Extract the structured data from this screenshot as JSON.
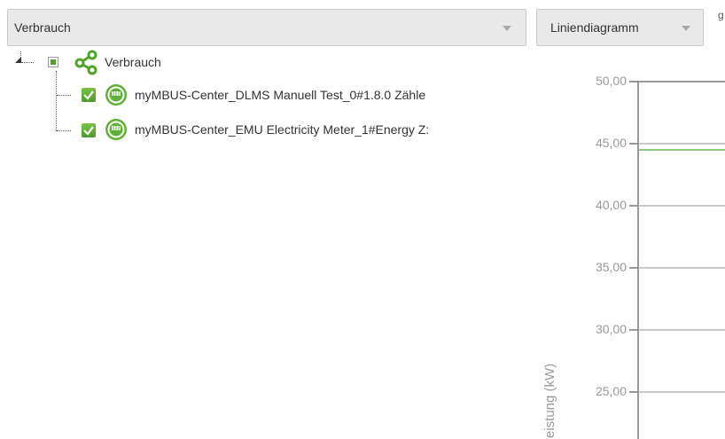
{
  "toolbar": {
    "source_select": {
      "value": "Verbrauch"
    },
    "chart_type_select": {
      "value": "Liniendiagramm"
    },
    "clipped_text": "g"
  },
  "tree": {
    "root": {
      "label": "Verbrauch",
      "icon": "share-icon"
    },
    "children": [
      {
        "label": "myMBUS-Center_DLMS Manuell Test_0#1.8.0 Zähle",
        "icon": "meter-icon",
        "checked": true
      },
      {
        "label": "myMBUS-Center_EMU Electricity Meter_1#Energy Z:",
        "icon": "meter-icon",
        "checked": true
      }
    ]
  },
  "chart_data": {
    "type": "line",
    "ylabel": "eistung (kW)",
    "yticks": [
      "50,00",
      "45,00",
      "40,00",
      "35,00",
      "30,00",
      "25,00"
    ],
    "ylim_visible": [
      22.5,
      50
    ],
    "grid": true,
    "series": [
      {
        "color": "#8cc97a",
        "values": [
          44.5
        ]
      }
    ]
  },
  "colors": {
    "accent_green": "#4fa32b",
    "grid": "#b5b5b5",
    "axis_text": "#999999"
  }
}
